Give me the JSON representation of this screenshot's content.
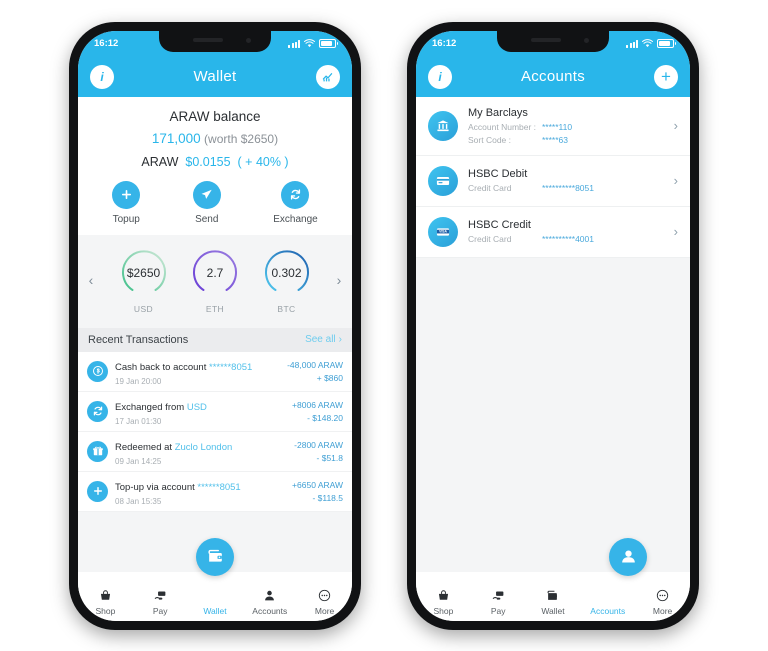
{
  "theme": {
    "accent": "#29b6ea",
    "accent_dark": "#2a9fd8",
    "text": "#2b2f33",
    "muted": "#a8aeb3"
  },
  "phone_left": {
    "status_bar": {
      "time": "16:12",
      "signal_icon": "signal-bars-icon",
      "wifi_icon": "wifi-icon",
      "battery_icon": "battery-icon"
    },
    "header": {
      "title": "Wallet",
      "left_icon": "info-icon",
      "left_label": "i",
      "right_icon": "chart-icon"
    },
    "balance": {
      "label": "ARAW balance",
      "amount": "171,000",
      "worth": "(worth $2650)",
      "ticker": "ARAW",
      "price": "$0.0155",
      "change": "( + 40% )"
    },
    "actions": [
      {
        "label": "Topup",
        "icon": "plus-icon"
      },
      {
        "label": "Send",
        "icon": "send-paper-plane-icon"
      },
      {
        "label": "Exchange",
        "icon": "exchange-refresh-icon"
      }
    ],
    "gauges": {
      "prev_icon": "chevron-left-icon",
      "next_icon": "chevron-right-icon",
      "items": [
        {
          "value": "$2650",
          "caption": "USD",
          "color": "#4cbf8a"
        },
        {
          "value": "2.7",
          "caption": "ETH",
          "color": "#7b4fd6"
        },
        {
          "value": "0.302",
          "caption": "BTC",
          "color": "#2f7fd0"
        }
      ]
    },
    "transactions": {
      "header": "Recent Transactions",
      "see_all": "See all",
      "see_all_icon": "chevron-right-icon",
      "rows": [
        {
          "icon": "cashback-icon",
          "title": "Cash back to account",
          "title_highlight": "******8051",
          "date": "19 Jan 20:00",
          "amount_primary": "-48,000 ARAW",
          "amount_secondary": "+ $860"
        },
        {
          "icon": "exchange-refresh-icon",
          "title": "Exchanged from",
          "title_highlight": "USD",
          "date": "17 Jan 01:30",
          "amount_primary": "+8006 ARAW",
          "amount_secondary": "- $148.20"
        },
        {
          "icon": "gift-icon",
          "title": "Redeemed at",
          "title_highlight": "Zuclo London",
          "date": "09 Jan 14:25",
          "amount_primary": "-2800 ARAW",
          "amount_secondary": "- $51.8"
        },
        {
          "icon": "plus-icon",
          "title": "Top-up via account",
          "title_highlight": "******8051",
          "date": "08 Jan 15:35",
          "amount_primary": "+6650 ARAW",
          "amount_secondary": "- $118.5"
        }
      ]
    },
    "nav": {
      "active": "Wallet",
      "items": [
        {
          "label": "Shop",
          "icon": "basket-icon"
        },
        {
          "label": "Pay",
          "icon": "pay-hand-icon"
        },
        {
          "label": "Wallet",
          "icon": "wallet-icon"
        },
        {
          "label": "Accounts",
          "icon": "person-icon"
        },
        {
          "label": "More",
          "icon": "more-dots-icon"
        }
      ]
    }
  },
  "phone_right": {
    "status_bar": {
      "time": "16:12",
      "signal_icon": "signal-bars-icon",
      "wifi_icon": "wifi-icon",
      "battery_icon": "battery-icon"
    },
    "header": {
      "title": "Accounts",
      "left_icon": "info-icon",
      "left_label": "i",
      "right_icon": "plus-icon",
      "right_label": "+"
    },
    "accounts": [
      {
        "icon": "bank-building-icon",
        "name": "My Barclays",
        "fields": [
          {
            "key": "Account Number :",
            "value": "*****110"
          },
          {
            "key": "Sort Code          :",
            "value": "*****63"
          }
        ],
        "chevron": "chevron-right-icon"
      },
      {
        "icon": "credit-card-icon",
        "name": "HSBC Debit",
        "fields": [
          {
            "key": "Credit Card",
            "value": "**********8051"
          }
        ],
        "chevron": "chevron-right-icon"
      },
      {
        "icon": "visa-card-icon",
        "name": "HSBC Credit",
        "fields": [
          {
            "key": "Credit Card",
            "value": "**********4001"
          }
        ],
        "chevron": "chevron-right-icon"
      }
    ],
    "nav": {
      "active": "Accounts",
      "items": [
        {
          "label": "Shop",
          "icon": "basket-icon"
        },
        {
          "label": "Pay",
          "icon": "pay-hand-icon"
        },
        {
          "label": "Wallet",
          "icon": "wallet-icon"
        },
        {
          "label": "Accounts",
          "icon": "person-icon"
        },
        {
          "label": "More",
          "icon": "more-dots-icon"
        }
      ]
    }
  }
}
